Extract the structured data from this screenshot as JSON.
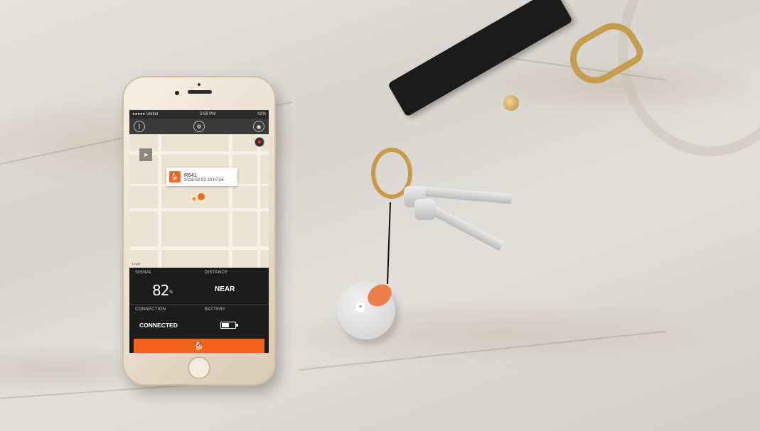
{
  "status_bar": {
    "carrier": "●●●●● Viettel",
    "time": "3:58 PM",
    "battery": "42%"
  },
  "toolbar": {
    "left_icon": "bluetooth-icon",
    "center_icon": "gear-icon",
    "right_icon": "camera-icon"
  },
  "map": {
    "popup": {
      "name": "R641",
      "timestamp": "2018-03-03 10:07:26"
    },
    "legal": "Legal"
  },
  "panel": {
    "signal_label": "SIGNAL",
    "signal_value": "82",
    "signal_unit": "%",
    "distance_label": "DISTANCE",
    "distance_value": "NEAR",
    "connection_label": "CONNECTION",
    "connection_value": "CONNECTED",
    "battery_label": "BATTERY",
    "battery_level": 0.5
  },
  "colors": {
    "accent": "#f2641b",
    "fob_accent": "#ef7d4c"
  }
}
